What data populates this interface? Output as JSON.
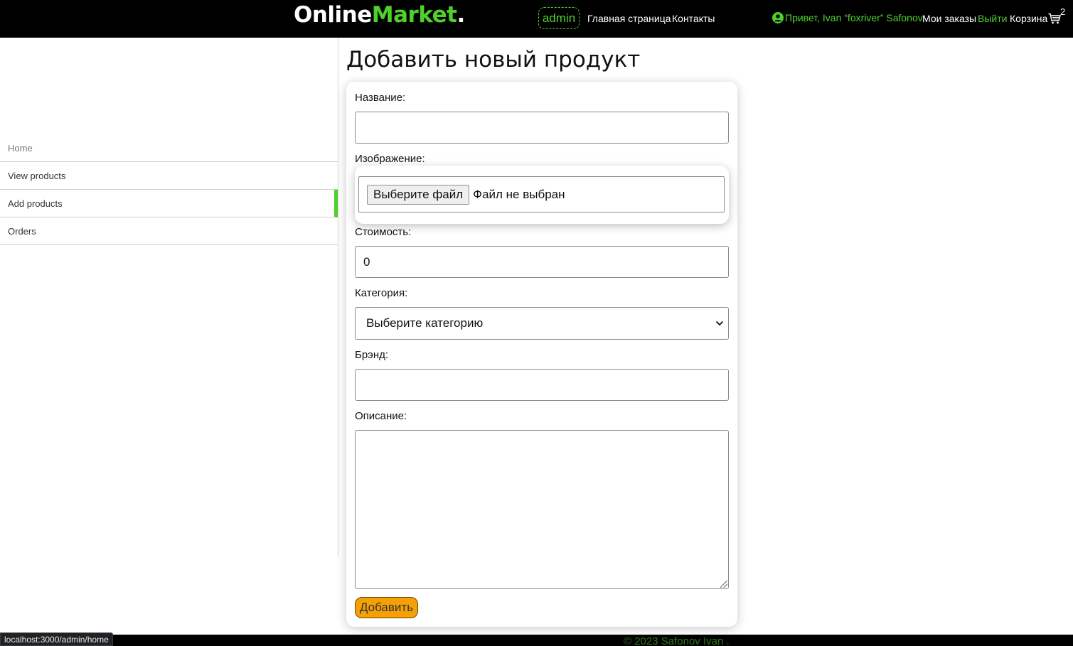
{
  "header": {
    "logo_prefix": "Online",
    "logo_suffix": "Market",
    "logo_dot": ".",
    "admin_label": "admin",
    "nav": [
      "Главная страница",
      "Контакты"
    ],
    "greeting": "Привет, Ivan “foxriver” Safonov",
    "my_orders": "Мои заказы",
    "logout": "Выйти",
    "cart": "Корзина",
    "cart_count": "2",
    "accent_color": "#4fd12b"
  },
  "sidebar": {
    "items": [
      "Home",
      "View products",
      "Add products",
      "Orders"
    ],
    "active": "Add products"
  },
  "form": {
    "title": "Добавить новый продукт",
    "name_label": "Название:",
    "name_value": "",
    "image_label": "Изображение:",
    "file_button": "Выберите файл",
    "file_status": "Файл не выбран",
    "price_label": "Стоимость:",
    "price_value": "0",
    "category_label": "Категория:",
    "category_selected": "Выберите категорию",
    "brand_label": "Брэнд:",
    "brand_value": "",
    "description_label": "Описание:",
    "description_value": "",
    "submit_label": "Добавить",
    "submit_color": "#f5a007"
  },
  "footer": {
    "copyright": "© 2023 Safonov Ivan ."
  },
  "status_bar": {
    "url": "localhost:3000/admin/home"
  }
}
